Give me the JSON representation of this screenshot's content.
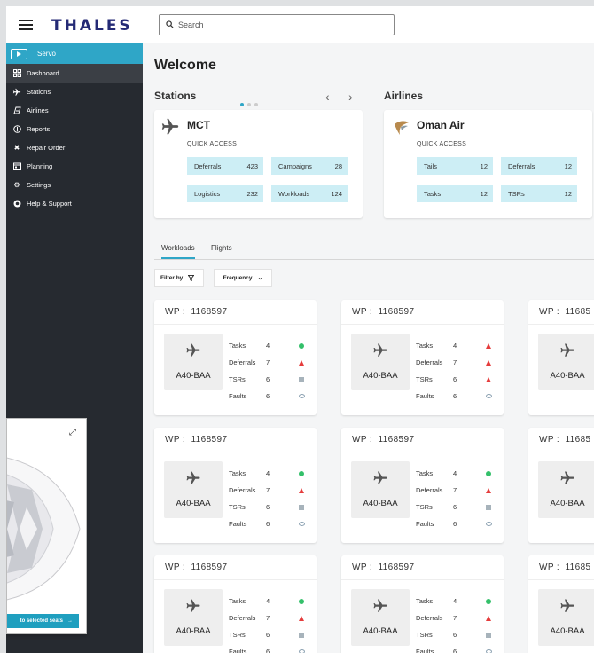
{
  "brand": "THALES",
  "search": {
    "placeholder": "Search"
  },
  "sidebar": {
    "app_name": "Servo",
    "items": [
      {
        "label": "Dashboard",
        "icon": "dashboard-icon"
      },
      {
        "label": "Stations",
        "icon": "plane-icon"
      },
      {
        "label": "Airlines",
        "icon": "airline-icon"
      },
      {
        "label": "Reports",
        "icon": "reports-icon"
      },
      {
        "label": "Repair Order",
        "icon": "tools-icon"
      },
      {
        "label": "Planning",
        "icon": "calendar-icon"
      },
      {
        "label": "Settings",
        "icon": "gear-icon"
      },
      {
        "label": "Help & Support",
        "icon": "help-icon"
      }
    ]
  },
  "main": {
    "welcome": "Welcome",
    "stations": {
      "title": "Stations",
      "card": {
        "name": "MCT",
        "subtitle": "QUICK ACCESS",
        "links": [
          {
            "label": "Deferrals",
            "value": "423"
          },
          {
            "label": "Campaigns",
            "value": "28"
          },
          {
            "label": "Logistics",
            "value": "232"
          },
          {
            "label": "Workloads",
            "value": "124"
          }
        ]
      }
    },
    "airlines": {
      "title": "Airlines",
      "card": {
        "name": "Oman Air",
        "subtitle": "QUICK ACCESS",
        "links": [
          {
            "label": "Tails",
            "value": "12"
          },
          {
            "label": "Deferrals",
            "value": "12"
          },
          {
            "label": "Tasks",
            "value": "12"
          },
          {
            "label": "TSRs",
            "value": "12"
          }
        ]
      }
    },
    "tabs": [
      "Workloads",
      "Flights"
    ],
    "filter_label": "Filter by",
    "frequency_label": "Frequency",
    "wp_prefix": "WP :",
    "workpackages": [
      {
        "id": "1168597",
        "tail": "A40-BAA",
        "stats": [
          {
            "label": "Tasks",
            "value": "4",
            "status": "ok"
          },
          {
            "label": "Deferrals",
            "value": "7",
            "status": "warn"
          },
          {
            "label": "TSRs",
            "value": "6",
            "status": "square"
          },
          {
            "label": "Faults",
            "value": "6",
            "status": "eye"
          }
        ]
      },
      {
        "id": "1168597",
        "tail": "A40-BAA",
        "stats": [
          {
            "label": "Tasks",
            "value": "4",
            "status": "warn"
          },
          {
            "label": "Deferrals",
            "value": "7",
            "status": "warn"
          },
          {
            "label": "TSRs",
            "value": "6",
            "status": "warn"
          },
          {
            "label": "Faults",
            "value": "6",
            "status": "eye"
          }
        ]
      },
      {
        "id": "11685",
        "tail": "A40-BAA",
        "stats": []
      },
      {
        "id": "1168597",
        "tail": "A40-BAA",
        "stats": [
          {
            "label": "Tasks",
            "value": "4",
            "status": "ok"
          },
          {
            "label": "Deferrals",
            "value": "7",
            "status": "warn"
          },
          {
            "label": "TSRs",
            "value": "6",
            "status": "square"
          },
          {
            "label": "Faults",
            "value": "6",
            "status": "eye"
          }
        ]
      },
      {
        "id": "1168597",
        "tail": "A40-BAA",
        "stats": [
          {
            "label": "Tasks",
            "value": "4",
            "status": "ok"
          },
          {
            "label": "Deferrals",
            "value": "7",
            "status": "warn"
          },
          {
            "label": "TSRs",
            "value": "6",
            "status": "square"
          },
          {
            "label": "Faults",
            "value": "6",
            "status": "eye"
          }
        ]
      },
      {
        "id": "11685",
        "tail": "A40-BAA",
        "stats": []
      },
      {
        "id": "1168597",
        "tail": "A40-BAA",
        "stats": [
          {
            "label": "Tasks",
            "value": "4",
            "status": "ok"
          },
          {
            "label": "Deferrals",
            "value": "7",
            "status": "warn"
          },
          {
            "label": "TSRs",
            "value": "6",
            "status": "square"
          },
          {
            "label": "Faults",
            "value": "6",
            "status": "eye"
          }
        ]
      },
      {
        "id": "1168597",
        "tail": "A40-BAA",
        "stats": [
          {
            "label": "Tasks",
            "value": "4",
            "status": "ok"
          },
          {
            "label": "Deferrals",
            "value": "7",
            "status": "warn"
          },
          {
            "label": "TSRs",
            "value": "6",
            "status": "square"
          },
          {
            "label": "Faults",
            "value": "6",
            "status": "eye"
          }
        ]
      },
      {
        "id": "11685",
        "tail": "A40-BAA",
        "stats": []
      }
    ]
  },
  "popup": {
    "cta_label": "to selected seats"
  },
  "colors": {
    "accent": "#2fa6c7",
    "sidebar": "#262a30",
    "quick_access": "#cdeef5",
    "ok": "#34c06a",
    "warn": "#e53c3c"
  }
}
